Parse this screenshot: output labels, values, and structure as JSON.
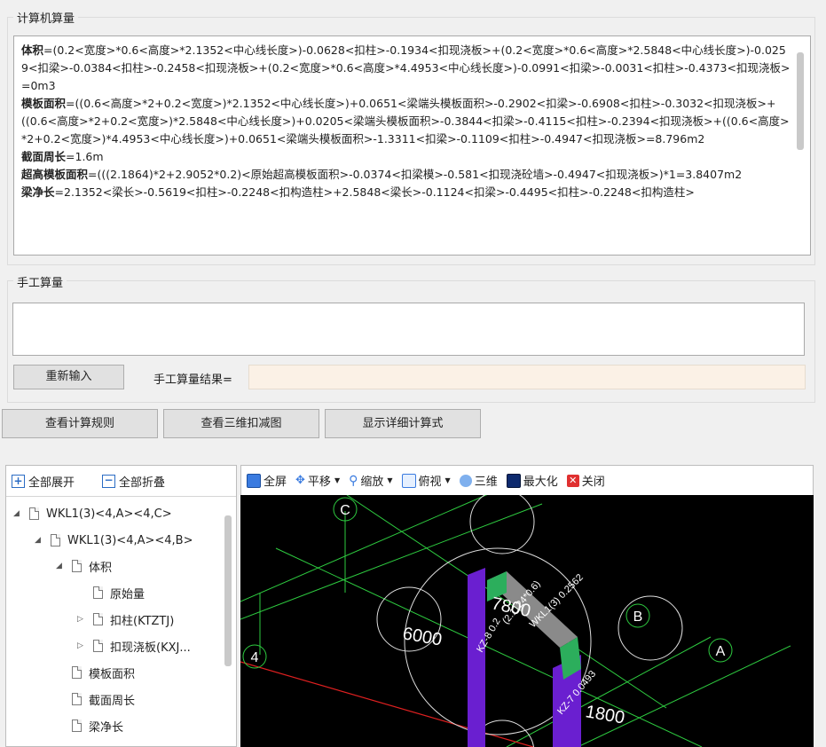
{
  "computer_section": {
    "title": "计算机算量",
    "lines": [
      {
        "label": "体积",
        "text": "=(0.2<宽度>*0.6<高度>*2.1352<中心线长度>)-0.0628<扣柱>-0.1934<扣现浇板>+(0.2<宽度>*0.6<高度>*2.5848<中心线长度>)-0.0259<扣梁>-0.0384<扣柱>-0.2458<扣现浇板>+(0.2<宽度>*0.6<高度>*4.4953<中心线长度>)-0.0991<扣梁>-0.0031<扣柱>-0.4373<扣现浇板>=0m3"
      },
      {
        "label": "模板面积",
        "text": "=((0.6<高度>*2+0.2<宽度>)*2.1352<中心线长度>)+0.0651<梁端头模板面积>-0.2902<扣梁>-0.6908<扣柱>-0.3032<扣现浇板>+((0.6<高度>*2+0.2<宽度>)*2.5848<中心线长度>)+0.0205<梁端头模板面积>-0.3844<扣梁>-0.4115<扣柱>-0.2394<扣现浇板>+((0.6<高度>*2+0.2<宽度>)*4.4953<中心线长度>)+0.0651<梁端头模板面积>-1.3311<扣梁>-0.1109<扣柱>-0.4947<扣现浇板>=8.796m2"
      },
      {
        "label": "截面周长",
        "text": "=1.6m"
      },
      {
        "label": "超高模板面积",
        "text": "=(((2.1864)*2+2.9052*0.2)<原始超高模板面积>-0.0374<扣梁模>-0.581<扣现浇砼墙>-0.4947<扣现浇板>)*1=3.8407m2"
      },
      {
        "label": "梁净长",
        "text": "=2.1352<梁长>-0.5619<扣柱>-0.2248<扣构造柱>+2.5848<梁长>-0.1124<扣梁>-0.4495<扣柱>-0.2248<扣构造柱>"
      }
    ]
  },
  "manual_section": {
    "title": "手工算量",
    "input_value": "",
    "reenter_label": "重新输入",
    "result_label": "手工算量结果=",
    "result_value": ""
  },
  "actions": {
    "view_rules": "查看计算规则",
    "view_3d": "查看三维扣减图",
    "show_detail": "显示详细计算式"
  },
  "tree": {
    "expand_all": "全部展开",
    "collapse_all": "全部折叠",
    "items": [
      {
        "label": "WKL1(3)<4,A><4,C>",
        "arrow": "◢"
      },
      {
        "label": "WKL1(3)<4,A><4,B>",
        "arrow": "◢"
      },
      {
        "label": "体积",
        "arrow": "◢"
      },
      {
        "label": "原始量",
        "arrow": ""
      },
      {
        "label": "扣柱(KTZTJ)",
        "arrow": "▷"
      },
      {
        "label": "扣现浇板(KXJ...",
        "arrow": "▷"
      },
      {
        "label": "模板面积",
        "arrow": ""
      },
      {
        "label": "截面周长",
        "arrow": ""
      },
      {
        "label": "梁净长",
        "arrow": ""
      }
    ]
  },
  "viewer_toolbar": {
    "fullscreen": "全屏",
    "pan": "平移",
    "zoom": "缩放",
    "top_view": "俯视",
    "three_d": "三维",
    "maximize": "最大化",
    "close": "关闭"
  },
  "scene": {
    "axis_labels": [
      "C",
      "B",
      "A",
      "4"
    ],
    "dimensions": [
      "7800",
      "6000",
      "1800"
    ],
    "element_labels": [
      "KZ-8 0.2",
      "(2.1124*0.6)",
      "WKL1(3) 0.2562",
      "KZ-7 0.0493"
    ],
    "colors": {
      "background": "#000000",
      "axis_green": "#2ecc40",
      "column_purple": "#6a1fd0",
      "beam_grey": "#8a8a8a",
      "red_line": "#e02020"
    }
  }
}
